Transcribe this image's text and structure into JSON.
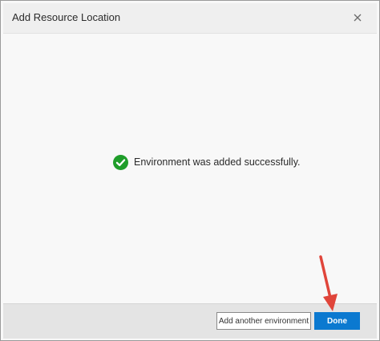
{
  "dialog": {
    "title": "Add Resource Location",
    "close_icon": "close-icon"
  },
  "body": {
    "status_icon": "check-circle-icon",
    "status_color": "#1f9d2a",
    "message": "Environment was added successfully."
  },
  "footer": {
    "secondary_label": "Add another environment",
    "primary_label": "Done",
    "primary_color": "#0b79d0"
  },
  "annotation": {
    "arrow_icon": "red-arrow-icon",
    "color": "#e0453a"
  }
}
